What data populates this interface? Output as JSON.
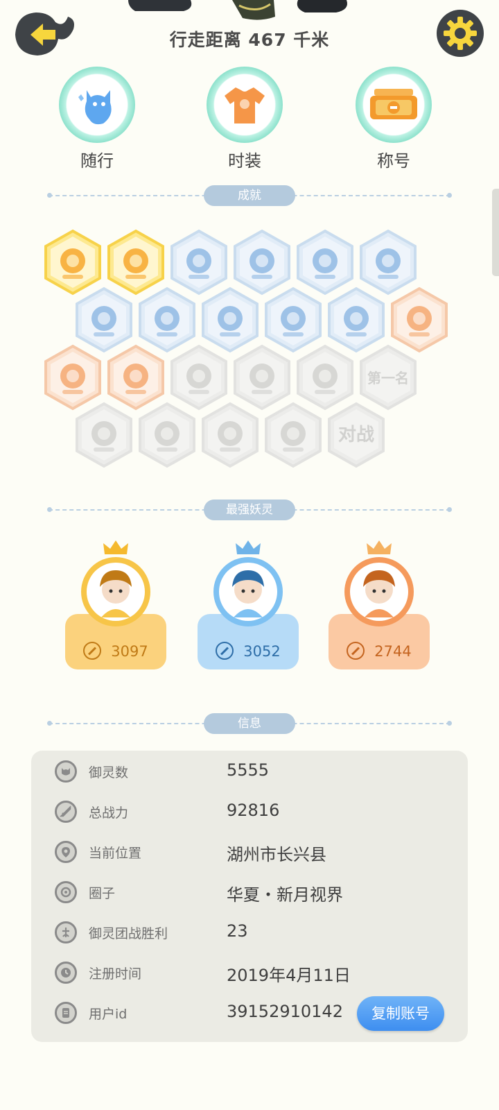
{
  "header": {
    "title": "行走距离 467 千米",
    "back_icon": "back-arrow-icon",
    "settings_icon": "gear-icon"
  },
  "features": [
    {
      "label": "随行",
      "icon": "companion-ghost-icon"
    },
    {
      "label": "时装",
      "icon": "tshirt-icon"
    },
    {
      "label": "称号",
      "icon": "title-plaque-icon"
    }
  ],
  "sections": {
    "achievements": "成就",
    "strongest": "最强妖灵",
    "info": "信息"
  },
  "achievements": {
    "rows": [
      [
        {
          "icon": "fox-badge-icon",
          "state": "gold"
        },
        {
          "icon": "yin-yang-badge-icon",
          "state": "gold"
        },
        {
          "icon": "sneaker-icon",
          "state": "blue"
        },
        {
          "icon": "portal-icon",
          "state": "blue"
        },
        {
          "icon": "moon-icon",
          "state": "blue"
        },
        {
          "icon": "crystal-ball-icon",
          "state": "blue"
        }
      ],
      [
        {
          "icon": "crystal-icon",
          "state": "blue"
        },
        {
          "icon": "yin-yang-swirl-icon",
          "state": "blue"
        },
        {
          "icon": "spirit-fountain-icon",
          "state": "blue"
        },
        {
          "icon": "cat-balloon-icon",
          "state": "blue"
        },
        {
          "icon": "angry-cloud-icon",
          "state": "blue"
        },
        {
          "icon": "scroll-seal-icon",
          "state": "orange"
        }
      ],
      [
        {
          "icon": "bull-statue-icon",
          "state": "orange"
        },
        {
          "icon": "cat-pair-icon",
          "state": "orange"
        },
        {
          "icon": "cart-cat-icon",
          "state": "gray"
        },
        {
          "icon": "dragon-icon",
          "state": "gray"
        },
        {
          "icon": "cat-book-icon",
          "state": "gray"
        },
        {
          "icon": "first-place-icon",
          "state": "gray",
          "text": "第一名"
        }
      ],
      [
        {
          "icon": "shield-badge-icon",
          "state": "gray"
        },
        {
          "icon": "crossed-swords-icon",
          "state": "gray"
        },
        {
          "icon": "hearts-spirits-icon",
          "state": "gray"
        },
        {
          "icon": "cat-list-icon",
          "state": "gray"
        },
        {
          "icon": "battle-icon",
          "state": "gray",
          "text": "对战"
        }
      ]
    ]
  },
  "strongest": [
    {
      "power": "3097",
      "card_color": "#fbd27d",
      "text_color": "#c07a16",
      "ring_color": "#f7c548",
      "crown_color": "#f5b92e",
      "avatar": "green-hair-warrior-avatar"
    },
    {
      "power": "3052",
      "card_color": "#b6dbf7",
      "text_color": "#2e6ea8",
      "ring_color": "#7ec1f2",
      "crown_color": "#6fb3e8",
      "avatar": "purple-hair-maiden-avatar"
    },
    {
      "power": "2744",
      "card_color": "#fbc9a3",
      "text_color": "#c4641f",
      "ring_color": "#f59a5c",
      "crown_color": "#f5b160",
      "avatar": "fox-ear-girl-avatar"
    }
  ],
  "info": {
    "rows": [
      {
        "key": "御灵数",
        "value": "5555",
        "icon": "spirit-count-icon"
      },
      {
        "key": "总战力",
        "value": "92816",
        "icon": "sword-power-icon"
      },
      {
        "key": "当前位置",
        "value": "湖州市长兴县",
        "icon": "location-pin-icon"
      },
      {
        "key": "圈子",
        "value": "华夏・新月视界",
        "icon": "circle-group-icon"
      },
      {
        "key": "御灵团战胜利",
        "value": "23",
        "icon": "team-battle-icon"
      },
      {
        "key": "注册时间",
        "value": "2019年4月11日",
        "icon": "clock-icon"
      },
      {
        "key": "用户id",
        "value": "39152910142",
        "icon": "id-card-icon"
      }
    ],
    "copy_button": "复制账号"
  },
  "colors": {
    "gold": "#f8d24f",
    "blue": "#c6daf0",
    "orange": "#f6c3a5",
    "gray": "#e2e2e2",
    "accent_button": "#4b97f2"
  }
}
